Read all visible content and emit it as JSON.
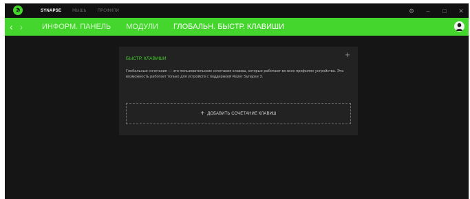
{
  "app": {
    "tabs": [
      {
        "label": "SYNAPSE",
        "active": true
      },
      {
        "label": "МЫШЬ",
        "active": false
      },
      {
        "label": "ПРОФИЛИ",
        "active": false
      }
    ],
    "window_controls": {
      "settings": "⚙",
      "minimize": "–",
      "maximize": "□",
      "close": "✕"
    }
  },
  "nav": {
    "back": "‹",
    "forward": "›",
    "tabs": [
      {
        "label": "ИНФОРМ. ПАНЕЛЬ",
        "active": false
      },
      {
        "label": "МОДУЛИ",
        "active": false
      },
      {
        "label": "ГЛОБАЛЬН. БЫСТР. КЛАВИШИ",
        "active": true
      }
    ]
  },
  "card": {
    "title": "БЫСТР. КЛАВИШИ",
    "add_symbol": "+",
    "description": "Глобальные сочетания — это пользовательские сочетания клавиш, которые работают во всех профилях устройства. Эта возможность работает только для устройств с поддержкой Razer Synapse 3.",
    "add_button": {
      "plus": "+",
      "label": "ДОБАВИТЬ СОЧЕТАНИЕ КЛАВИШ"
    }
  },
  "colors": {
    "accent": "#44d62c",
    "background": "#151515",
    "card": "#222222",
    "titlebar": "#111111"
  },
  "icons": {
    "logo": "razer-logo-icon",
    "avatar": "user-avatar-icon"
  }
}
